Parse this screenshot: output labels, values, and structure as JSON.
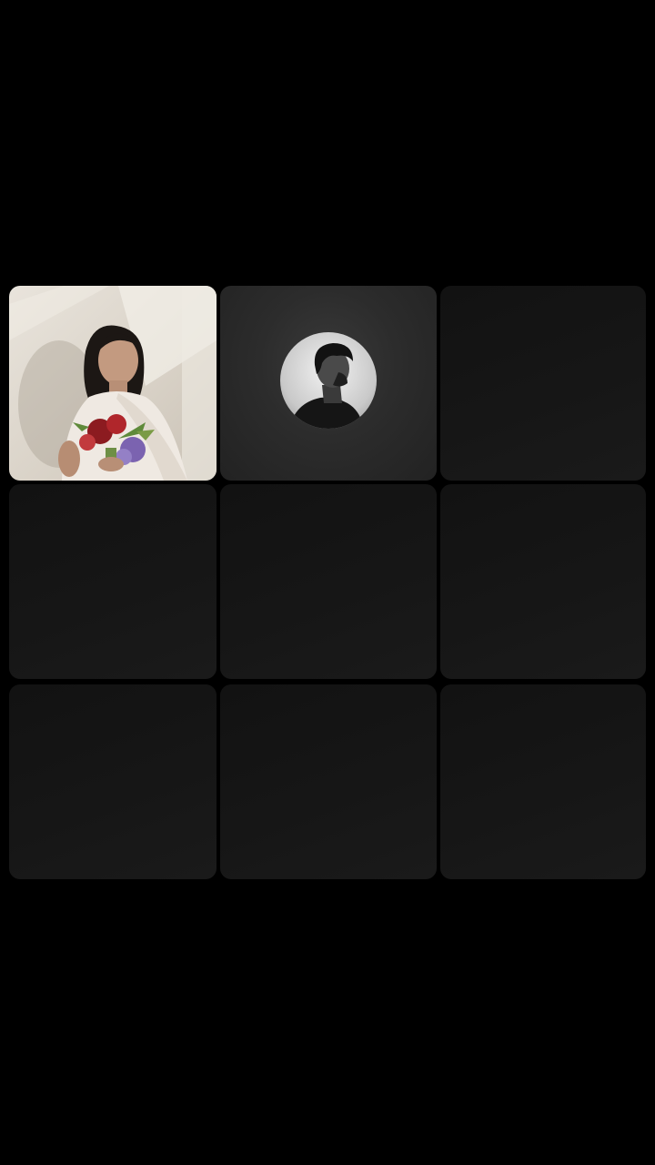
{
  "screen": {
    "background": "#000000"
  },
  "call_grid": {
    "tiles": [
      {
        "kind": "video",
        "content": "woman-with-bouquet-photo"
      },
      {
        "kind": "avatar",
        "content": "man-profile-avatar"
      },
      {
        "kind": "empty"
      },
      {
        "kind": "empty"
      },
      {
        "kind": "empty"
      },
      {
        "kind": "empty"
      },
      {
        "kind": "empty"
      },
      {
        "kind": "empty"
      },
      {
        "kind": "empty"
      }
    ],
    "colors": {
      "empty_tile": "#151515",
      "active_tile": "#2e2e2e"
    }
  }
}
